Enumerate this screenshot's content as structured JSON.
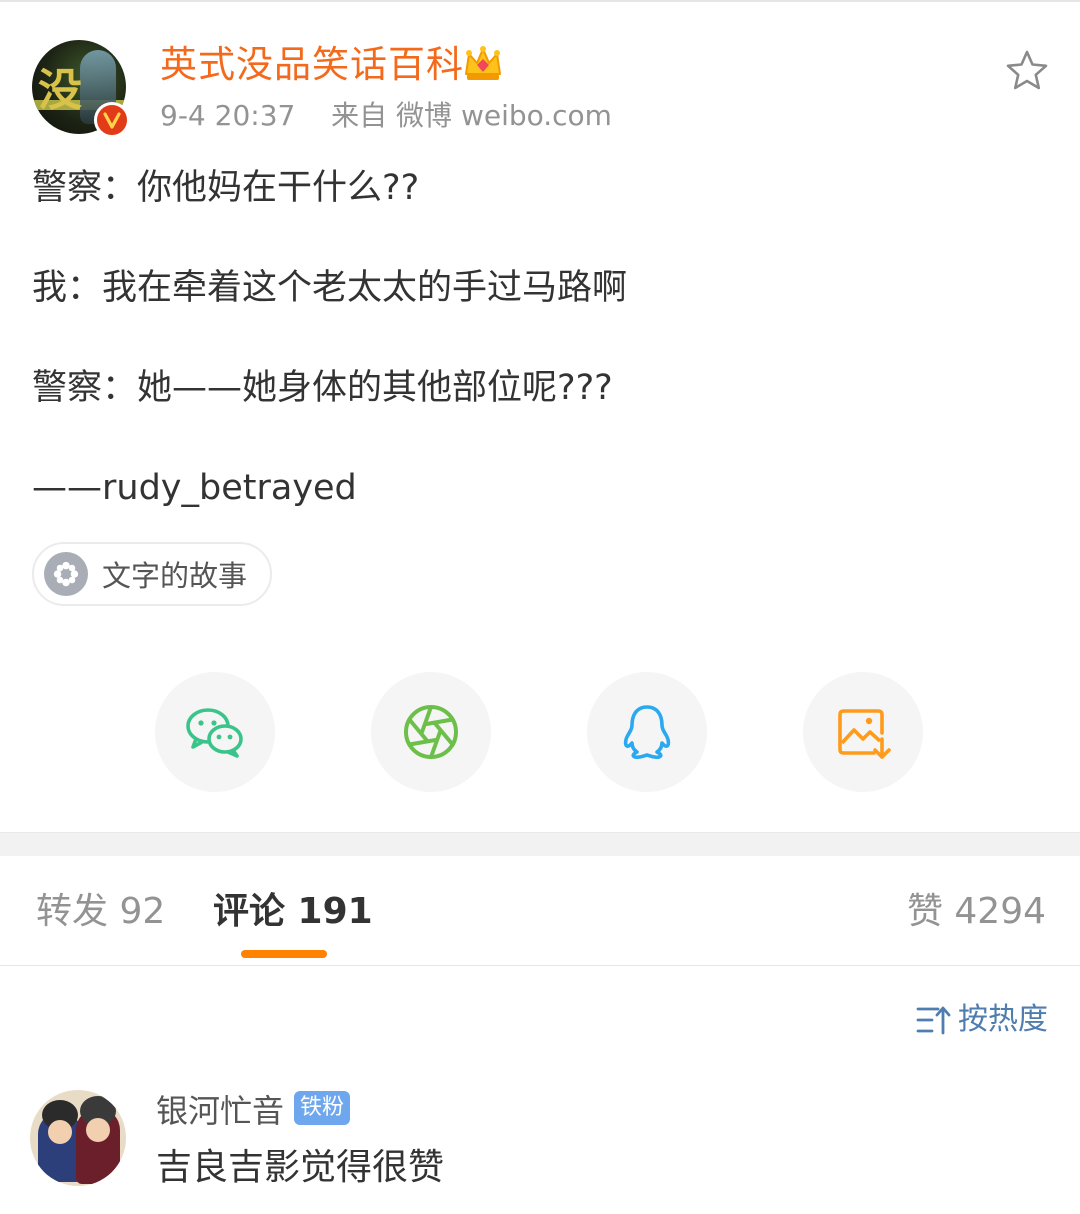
{
  "post": {
    "author": "英式没品笑话百科",
    "time": "9-4 20:37",
    "source": "来自 微博 weibo.com",
    "lines": [
      "警察：你他妈在干什么??",
      "我：我在牵着这个老太太的手过马路啊",
      "警察：她——她身体的其他部位呢???",
      "——rudy_betrayed"
    ],
    "topic": "文字的故事",
    "icons": {
      "avatar_badge": "verified-v-icon",
      "crown": "crown-icon",
      "favorite": "star-icon",
      "topic": "flower-icon"
    },
    "avatar_text": "没"
  },
  "share": [
    {
      "name": "wechat",
      "icon": "wechat-icon",
      "color": "#3bc48a"
    },
    {
      "name": "moments",
      "icon": "moments-shutter-icon",
      "color": "#6cc04a"
    },
    {
      "name": "qq",
      "icon": "qq-penguin-icon",
      "color": "#2aa8f0"
    },
    {
      "name": "save-image",
      "icon": "image-download-icon",
      "color": "#ff9b1a"
    }
  ],
  "tabs": {
    "repost": "转发 92",
    "comments": "评论 191",
    "likes": "赞 4294",
    "active": "comments",
    "accent": "#ff8200"
  },
  "sort": {
    "label": "按热度",
    "icon": "sort-icon"
  },
  "comments": [
    {
      "user": "银河忙音",
      "badge": "铁粉",
      "text": "吉良吉影觉得很赞"
    }
  ],
  "colors": {
    "author": "#f36a1c",
    "meta": "#939393",
    "link": "#507daf",
    "badge": "#6ea7ee"
  }
}
